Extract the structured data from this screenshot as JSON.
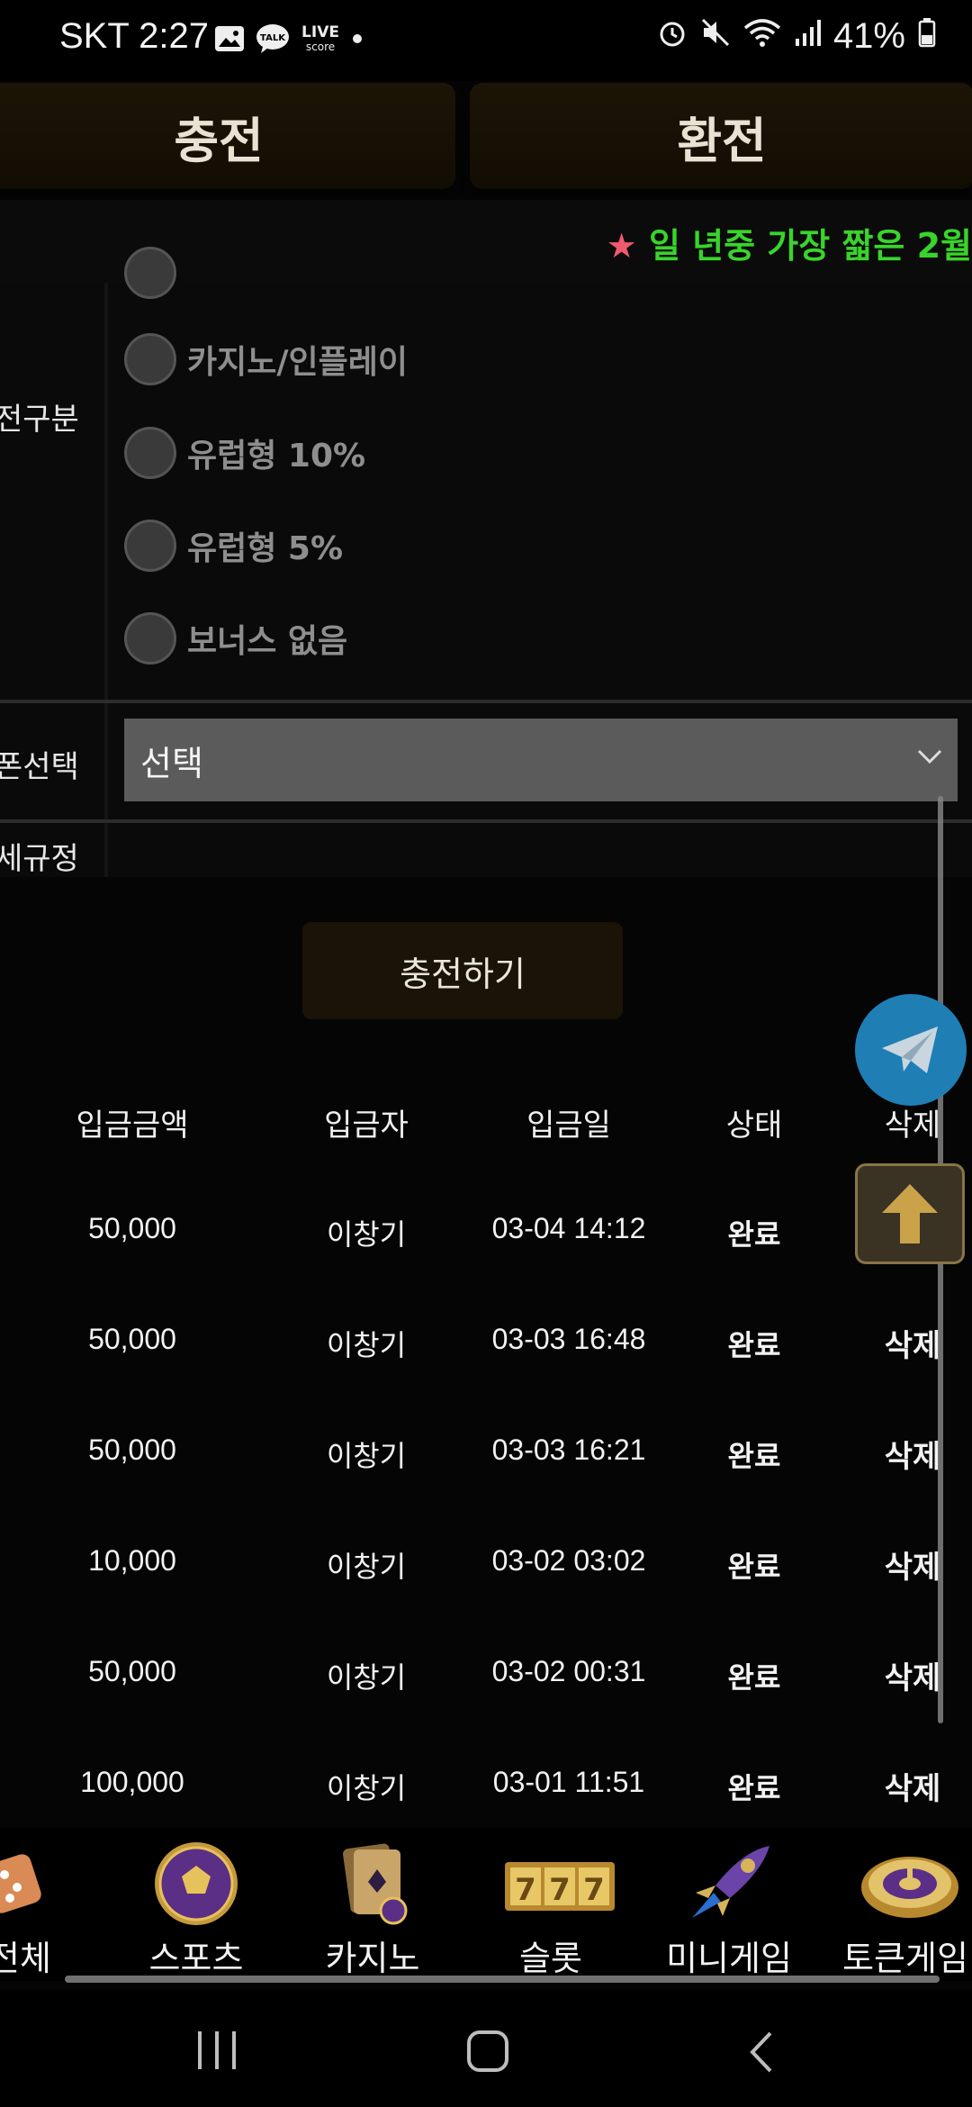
{
  "status_bar": {
    "carrier_time": "SKT 2:27",
    "battery": "41%"
  },
  "tabs": [
    {
      "label": "충전"
    },
    {
      "label": "환전"
    }
  ],
  "ticker": {
    "text": "일 년중 가장 짧은 2월"
  },
  "form": {
    "deposit_type_label": "전구분",
    "options": [
      {
        "label": "카지노/인플레이"
      },
      {
        "label": "유럽형 10%"
      },
      {
        "label": "유럽형 5%"
      },
      {
        "label": "보너스 없음"
      }
    ],
    "coupon_label": "폰선택",
    "coupon_select_value": "선택",
    "rules_label": "세규정"
  },
  "charge_button": {
    "label": "충전하기"
  },
  "table": {
    "headers": [
      "입금금액",
      "입금자",
      "입금일",
      "상태",
      "삭제"
    ],
    "rows": [
      {
        "amount": "50,000",
        "depositor": "이창기",
        "date": "03-04 14:12",
        "status": "완료",
        "delete": ""
      },
      {
        "amount": "50,000",
        "depositor": "이창기",
        "date": "03-03 16:48",
        "status": "완료",
        "delete": "삭제"
      },
      {
        "amount": "50,000",
        "depositor": "이창기",
        "date": "03-03 16:21",
        "status": "완료",
        "delete": "삭제"
      },
      {
        "amount": "10,000",
        "depositor": "이창기",
        "date": "03-02 03:02",
        "status": "완료",
        "delete": "삭제"
      },
      {
        "amount": "50,000",
        "depositor": "이창기",
        "date": "03-02 00:31",
        "status": "완료",
        "delete": "삭제"
      },
      {
        "amount": "100,000",
        "depositor": "이창기",
        "date": "03-01 11:51",
        "status": "완료",
        "delete": "삭제"
      }
    ]
  },
  "category_nav": [
    {
      "label": "전체",
      "icon": "dice-icon"
    },
    {
      "label": "스포츠",
      "icon": "soccer-ball-icon"
    },
    {
      "label": "카지노",
      "icon": "cards-icon"
    },
    {
      "label": "슬롯",
      "icon": "slot-777-icon"
    },
    {
      "label": "미니게임",
      "icon": "rocket-icon"
    },
    {
      "label": "토큰게임",
      "icon": "roulette-icon"
    }
  ],
  "colors": {
    "ticker_green": "#39d42b",
    "star_red": "#f05a6e",
    "telegram_blue": "#1f7fb5",
    "gold": "#c9a24a"
  }
}
